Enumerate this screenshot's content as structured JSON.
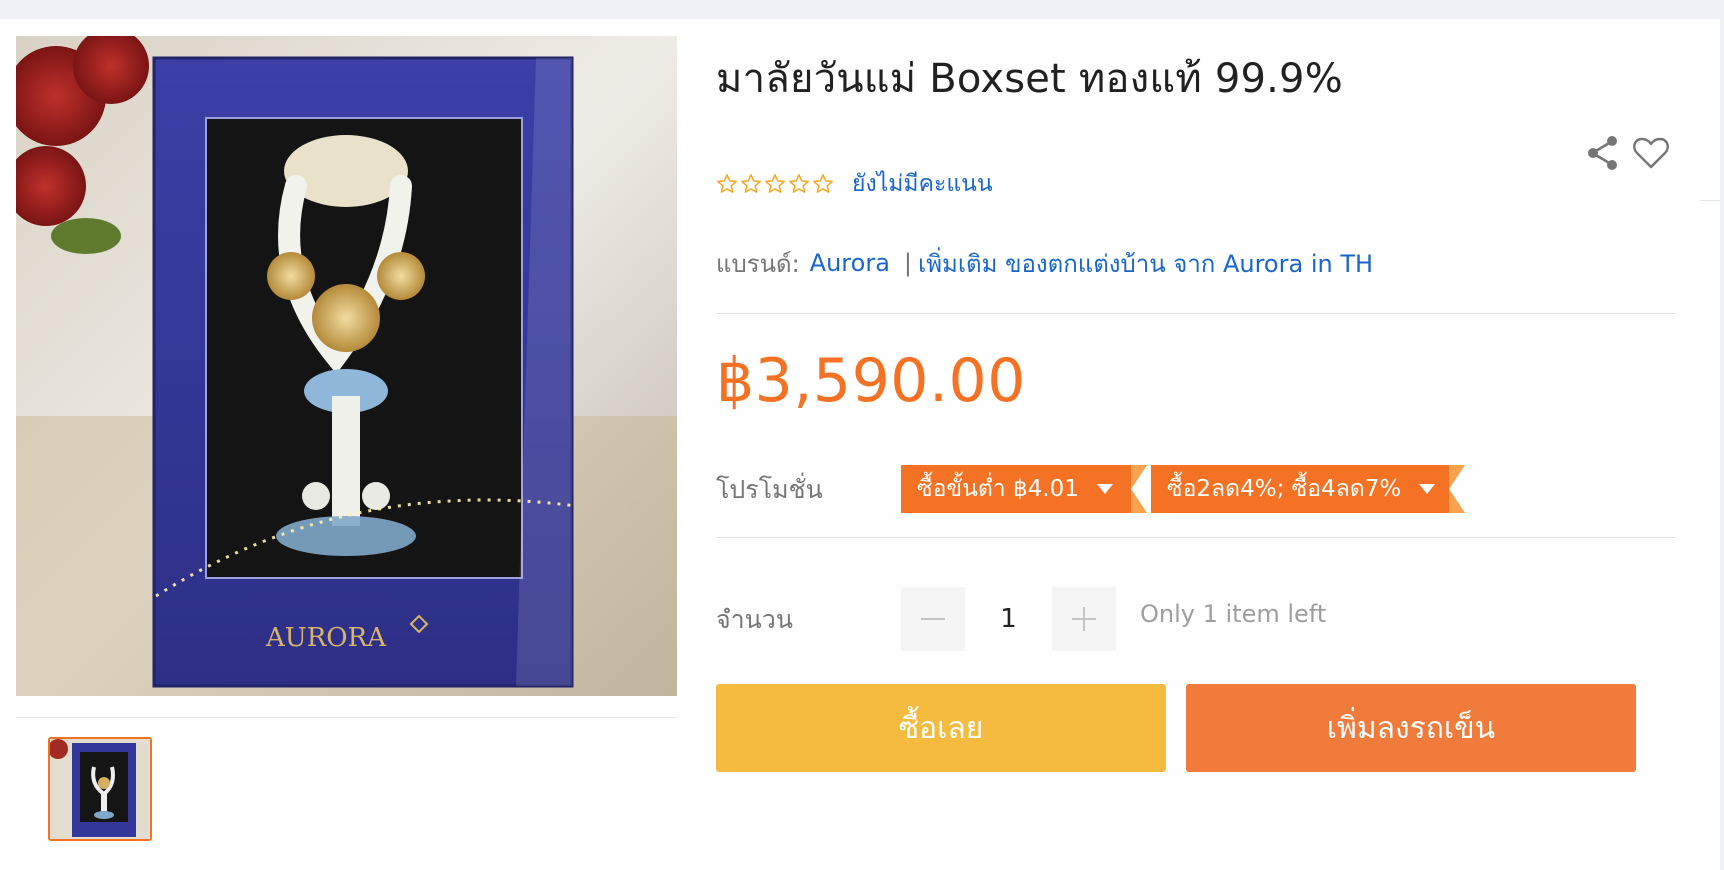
{
  "product": {
    "title": "มาลัยวันแม่ Boxset ทองแท้ 99.9%",
    "rating": {
      "stars": 0,
      "max_stars": 5,
      "label": "ยังไม่มีคะแนน"
    },
    "brand": {
      "label": "แบรนด์:",
      "name": "Aurora",
      "separator": "|",
      "more_link": "เพิ่มเติม ของตกแต่งบ้าน จาก Aurora in TH"
    },
    "price": "฿3,590.00",
    "promotions": {
      "label": "โปรโมชั่น",
      "items": [
        {
          "text": "ซื้อขั้นต่ำ ฿4.01"
        },
        {
          "text": "ซื้อ2ลด4%; ซื้อ4ลด7%"
        }
      ]
    },
    "quantity": {
      "label": "จำนวน",
      "value": "1",
      "stock_note": "Only 1 item left"
    },
    "image_text": {
      "box_brand": "AURORA"
    }
  },
  "actions": {
    "buy_now": "ซื้อเลย",
    "add_to_cart": "เพิ่มลงรถเข็น",
    "share_icon": "share-icon",
    "wishlist_icon": "heart-icon"
  },
  "colors": {
    "accent": "#f57224",
    "link": "#1a66cc",
    "buy_now": "#f5bb3f",
    "add_to_cart": "#f07b3a",
    "star": "#f5a623"
  }
}
